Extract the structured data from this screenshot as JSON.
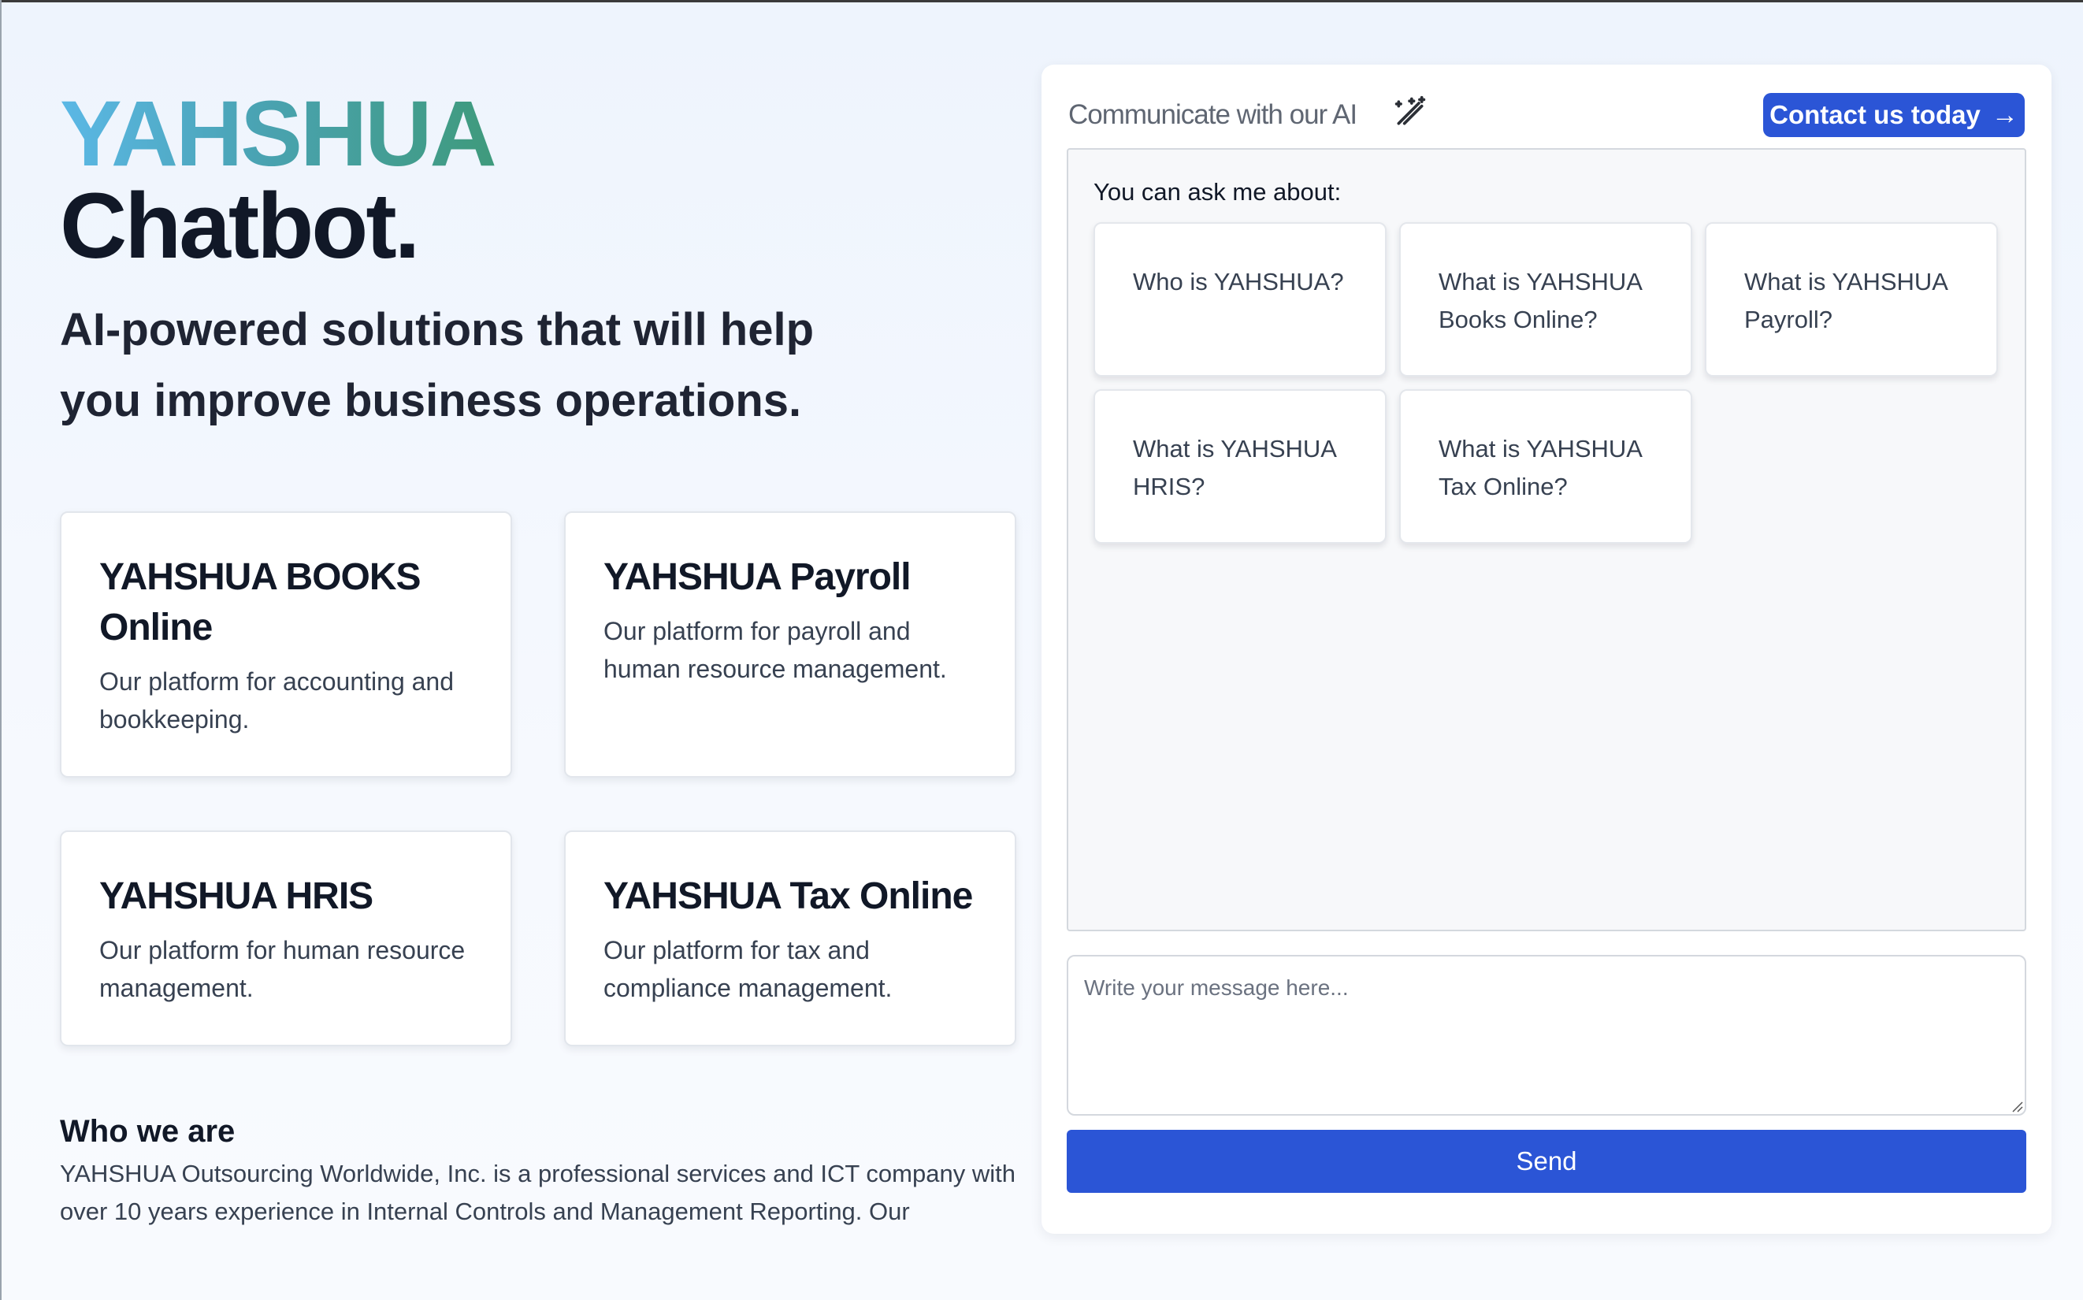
{
  "hero": {
    "brand": "YAHSHUA",
    "title": "Chatbot.",
    "tagline_line1": "AI-powered solutions that will help",
    "tagline_line2": "you improve business operations."
  },
  "products": [
    {
      "title": "YAHSHUA BOOKS Online",
      "description": "Our platform for accounting and bookkeeping."
    },
    {
      "title": "YAHSHUA Payroll",
      "description": "Our platform for payroll and human resource management."
    },
    {
      "title": "YAHSHUA HRIS",
      "description": "Our platform for human resource management."
    },
    {
      "title": "YAHSHUA Tax Online",
      "description": "Our platform for tax and compliance management."
    }
  ],
  "about": {
    "heading": "Who we are",
    "text": "YAHSHUA Outsourcing Worldwide, Inc. is a professional services and ICT company with over 10 years experience in Internal Controls and Management Reporting. Our"
  },
  "chat": {
    "header_title": "Communicate with our AI",
    "header_icon": "magic-wand-icon",
    "contact_label": "Contact us today",
    "contact_icon": "arrow-right-icon",
    "ask_label": "You can ask me about:",
    "suggestions": [
      "Who is YAHSHUA?",
      "What is YAHSHUA Books Online?",
      "What is YAHSHUA Payroll?",
      "What is YAHSHUA HRIS?",
      "What is YAHSHUA Tax Online?"
    ],
    "input_placeholder": "Write your message here...",
    "input_value": "",
    "send_label": "Send"
  },
  "colors": {
    "accent": "#2b55d6",
    "brand_gradient_start": "#5bb8e6",
    "brand_gradient_end": "#3f9a7c"
  }
}
